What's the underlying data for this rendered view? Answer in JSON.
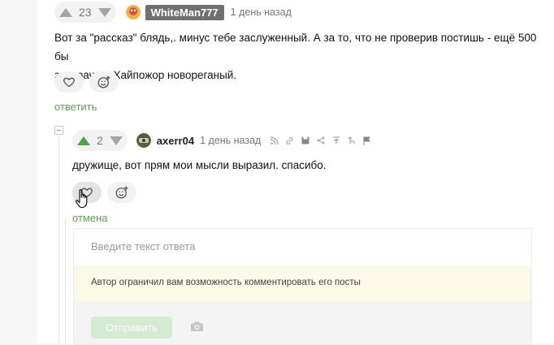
{
  "comment1": {
    "votes": "23",
    "author": "WhiteMan777",
    "time": "1 день назад",
    "text_line1": "Вот за \"рассказ\" блядь,. минус тебе заслуженный. А за то, что не проверив постишь - ещё 500 бы",
    "text_line2": "захерачил. Хайпожор новореганый.",
    "reply_link": "ответить"
  },
  "comment2": {
    "votes": "2",
    "author": "axerr04",
    "time": "1 день назад",
    "text": "дружище, вот прям мои мысли выразил. спасибо.",
    "cancel_link": "отмена"
  },
  "reply_form": {
    "placeholder": "Введите текст ответа",
    "notice": "Автор ограничил вам возможность комментировать его посты",
    "send_label": "Отправить"
  },
  "colors": {
    "accent_green": "#5aa24f",
    "vote_up_active": "#4fa146",
    "badge_gray": "#707070",
    "notice_bg": "#fdf9e8"
  }
}
